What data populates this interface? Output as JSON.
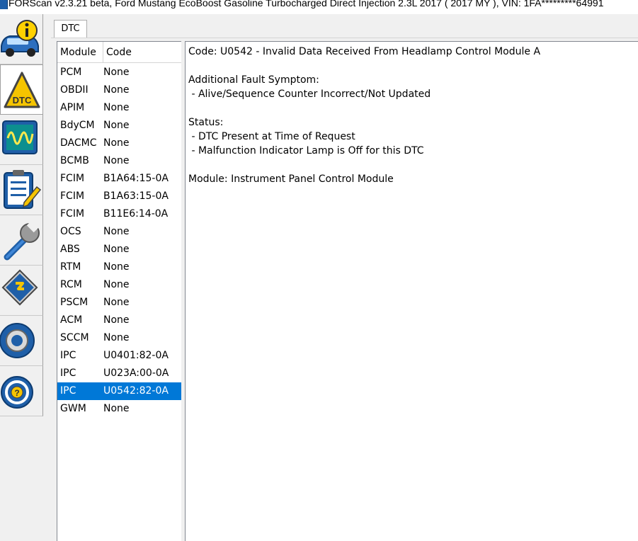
{
  "window": {
    "title": "FORScan v2.3.21 beta, Ford Mustang EcoBoost Gasoline Turbocharged Direct Injection 2.3L 2017 ( 2017 MY ), VIN: 1FA*********64991"
  },
  "toolbar": {
    "items": [
      {
        "name": "vehicle-info",
        "icon": "car-info-icon"
      },
      {
        "name": "dtc",
        "icon": "dtc-warning-icon",
        "label": "DTC",
        "active": true
      },
      {
        "name": "oscilloscope",
        "icon": "oscilloscope-icon"
      },
      {
        "name": "tests",
        "icon": "checklist-icon"
      },
      {
        "name": "service",
        "icon": "wrench-icon"
      },
      {
        "name": "configuration",
        "icon": "chip-icon"
      },
      {
        "name": "settings",
        "icon": "gear-icon"
      },
      {
        "name": "help",
        "icon": "help-wheel-icon"
      }
    ]
  },
  "tabs": [
    {
      "label": "DTC",
      "active": true
    }
  ],
  "dtc_list": {
    "columns": [
      "Module",
      "Code"
    ],
    "rows": [
      {
        "module": "PCM",
        "code": "None"
      },
      {
        "module": "OBDII",
        "code": "None"
      },
      {
        "module": "APIM",
        "code": "None"
      },
      {
        "module": "BdyCM",
        "code": "None"
      },
      {
        "module": "DACMC",
        "code": "None"
      },
      {
        "module": "BCMB",
        "code": "None"
      },
      {
        "module": "FCIM",
        "code": "B1A64:15-0A"
      },
      {
        "module": "FCIM",
        "code": "B1A63:15-0A"
      },
      {
        "module": "FCIM",
        "code": "B11E6:14-0A"
      },
      {
        "module": "OCS",
        "code": "None"
      },
      {
        "module": "ABS",
        "code": "None"
      },
      {
        "module": "RTM",
        "code": "None"
      },
      {
        "module": "RCM",
        "code": "None"
      },
      {
        "module": "PSCM",
        "code": "None"
      },
      {
        "module": "ACM",
        "code": "None"
      },
      {
        "module": "SCCM",
        "code": "None"
      },
      {
        "module": "IPC",
        "code": "U0401:82-0A"
      },
      {
        "module": "IPC",
        "code": "U023A:00-0A"
      },
      {
        "module": "IPC",
        "code": "U0542:82-0A",
        "selected": true
      },
      {
        "module": "GWM",
        "code": "None"
      }
    ]
  },
  "detail": {
    "lines": [
      "Code: U0542 - Invalid Data Received From Headlamp Control Module A",
      "",
      "Additional Fault Symptom:",
      " - Alive/Sequence Counter Incorrect/Not Updated",
      "",
      "Status:",
      " - DTC Present at Time of Request",
      " - Malfunction Indicator Lamp is Off for this DTC",
      "",
      "Module: Instrument Panel Control Module"
    ]
  },
  "colors": {
    "selection": "#0078d7",
    "toolbar_icon_blue": "#1f5fa8",
    "dtc_yellow": "#f5c400"
  }
}
